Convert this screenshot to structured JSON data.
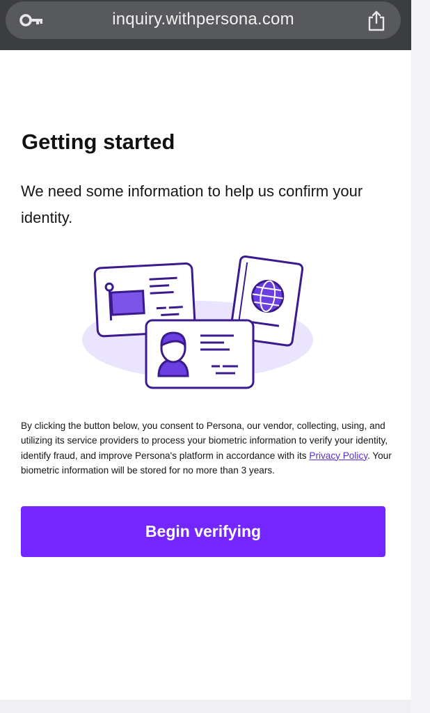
{
  "browser": {
    "url": "inquiry.withpersona.com",
    "icons": {
      "left": "key-icon",
      "right": "share-icon"
    }
  },
  "page": {
    "title": "Getting started",
    "subtitle": "We need some information to help us confirm your identity.",
    "illustration": "id-cards-and-passport",
    "consent": {
      "before_link": "By clicking the button below, you consent to Persona, our vendor, collecting, using, and utilizing its service providers to process your biometric information to verify your identity, identify fraud, and improve Persona's platform in accordance with its ",
      "link_label": "Privacy Policy",
      "after_link": ". Your biometric information will be stored for no more than 3 years."
    },
    "button_label": "Begin verifying"
  },
  "colors": {
    "accent": "#7426ff",
    "illustration_stroke": "#3a1a8c",
    "illustration_fill": "#eae4ff",
    "link": "#5b2bd6"
  }
}
